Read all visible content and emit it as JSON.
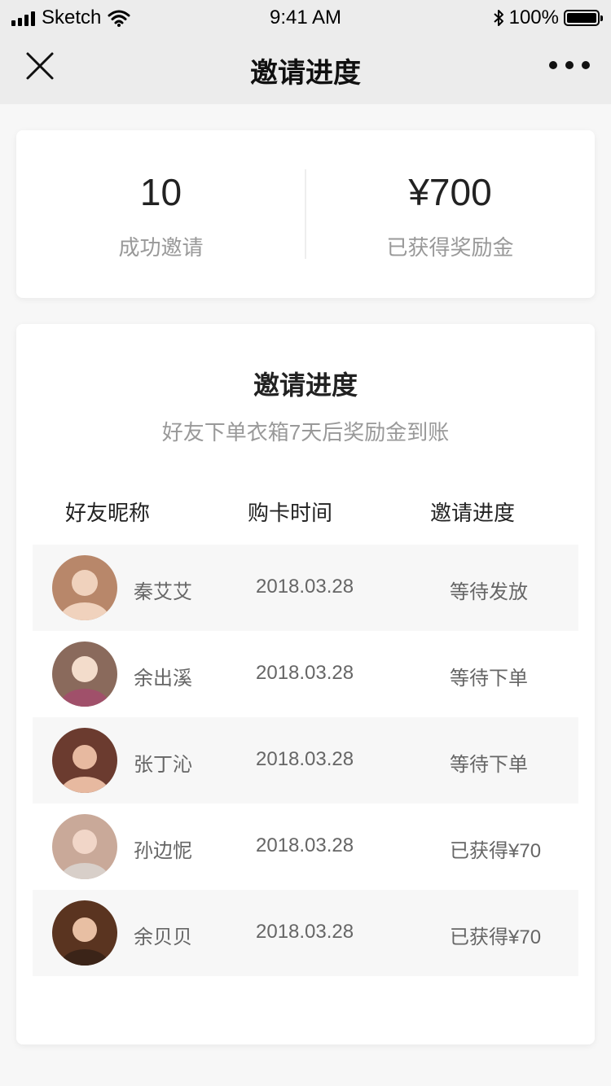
{
  "status_bar": {
    "carrier": "Sketch",
    "time": "9:41 AM",
    "battery_text": "100%",
    "battery_level": 1.0,
    "wifi_icon": "wifi-icon",
    "bluetooth_icon": "bluetooth-icon"
  },
  "nav": {
    "title": "邀请进度",
    "close_icon": "close-icon",
    "more_icon": "more-dots-icon"
  },
  "stats": {
    "invites_value": "10",
    "invites_label": "成功邀请",
    "reward_value": "¥700",
    "reward_label": "已获得奖励金"
  },
  "progress": {
    "title": "邀请进度",
    "subtitle": "好友下单衣箱7天后奖励金到账",
    "columns": [
      "好友昵称",
      "购卡时间",
      "邀请进度"
    ],
    "rows": [
      {
        "name": "秦艾艾",
        "time": "2018.03.28",
        "status": "等待发放",
        "avatar_color": "#b8876a"
      },
      {
        "name": "余出溪",
        "time": "2018.03.28",
        "status": "等待下单",
        "avatar_color": "#8a6a5c"
      },
      {
        "name": "张丁沁",
        "time": "2018.03.28",
        "status": "等待下单",
        "avatar_color": "#6b3b2f"
      },
      {
        "name": "孙边怩",
        "time": "2018.03.28",
        "status": "已获得¥70",
        "avatar_color": "#c9a999"
      },
      {
        "name": "余贝贝",
        "time": "2018.03.28",
        "status": "已获得¥70",
        "avatar_color": "#5a3420"
      }
    ]
  },
  "colors": {
    "bar_background": "#ececec",
    "page_background": "#f7f7f7",
    "card_background": "#ffffff",
    "muted_text": "#999999",
    "row_shade": "#f7f7f7"
  }
}
